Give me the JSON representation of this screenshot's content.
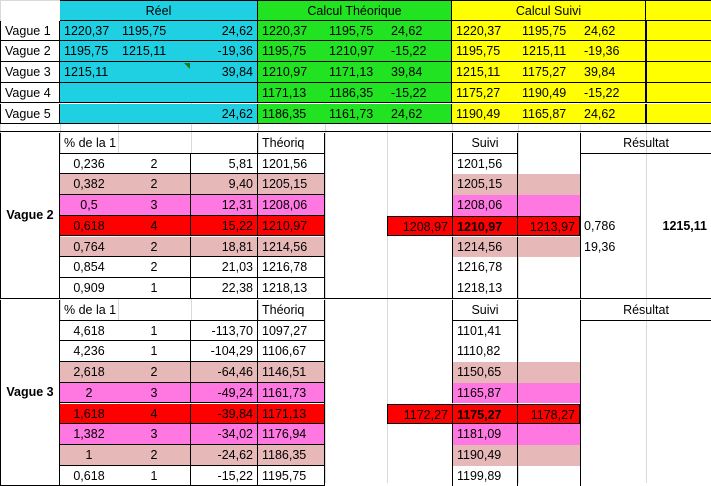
{
  "colors": {
    "cyan": "#1fd0e3",
    "green": "#21e321",
    "yellow": "#ffff00",
    "pink": "#e6b8b7",
    "magenta": "#ff77e0",
    "red": "#ff0000",
    "white": "#ffffff"
  },
  "sheet": {
    "top": {
      "headers": [
        "Réel",
        "Calcul Théorique",
        "Calcul Suivi"
      ],
      "rows": [
        {
          "label": "Vague 1",
          "reel": [
            "1220,37",
            "1195,75",
            "24,62"
          ],
          "theo": [
            "1220,37",
            "1195,75",
            "24,62"
          ],
          "suivi": [
            "1220,37",
            "1195,75",
            "24,62"
          ]
        },
        {
          "label": "Vague 2",
          "reel": [
            "1195,75",
            "1215,11",
            "-19,36"
          ],
          "theo": [
            "1195,75",
            "1210,97",
            "-15,22"
          ],
          "suivi": [
            "1195,75",
            "1215,11",
            "-19,36"
          ]
        },
        {
          "label": "Vague 3",
          "reel": [
            "1215,11",
            "",
            "39,84"
          ],
          "theo": [
            "1210,97",
            "1171,13",
            "39,84"
          ],
          "suivi": [
            "1215,11",
            "1175,27",
            "39,84"
          ]
        },
        {
          "label": "Vague 4",
          "reel": [
            "",
            "",
            ""
          ],
          "theo": [
            "1171,13",
            "1186,35",
            "-15,22"
          ],
          "suivi": [
            "1175,27",
            "1190,49",
            "-15,22"
          ]
        },
        {
          "label": "Vague 5",
          "reel": [
            "",
            "",
            "24,62"
          ],
          "theo": [
            "1186,35",
            "1161,73",
            "24,62"
          ],
          "suivi": [
            "1190,49",
            "1165,87",
            "24,62"
          ]
        }
      ]
    },
    "block1": {
      "label": "Vague 2",
      "headers": {
        "pct": "% de la 1",
        "theo": "Théoriq",
        "suivi": "Suivi",
        "result": "Résultat"
      },
      "rows": [
        {
          "pct": "0,236",
          "n": "2",
          "v": "5,81",
          "theo": "1201,56",
          "suivi": "1201,56",
          "bg": "white"
        },
        {
          "pct": "0,382",
          "n": "2",
          "v": "9,40",
          "theo": "1205,15",
          "suivi": "1205,15",
          "bg": "pink"
        },
        {
          "pct": "0,5",
          "n": "3",
          "v": "12,31",
          "theo": "1208,06",
          "suivi": "1208,06",
          "bg": "magenta"
        },
        {
          "pct": "0,618",
          "n": "4",
          "v": "15,22",
          "theo": "1210,97",
          "suivi": "1210,97",
          "bg": "red",
          "low": "1208,97",
          "high": "1213,97"
        },
        {
          "pct": "0,764",
          "n": "2",
          "v": "18,81",
          "theo": "1214,56",
          "suivi": "1214,56",
          "bg": "pink"
        },
        {
          "pct": "0,854",
          "n": "2",
          "v": "21,03",
          "theo": "1216,78",
          "suivi": "1216,78",
          "bg": "white"
        },
        {
          "pct": "0,909",
          "n": "1",
          "v": "22,38",
          "theo": "1218,13",
          "suivi": "1218,13",
          "bg": "white"
        }
      ],
      "result": {
        "ratio": "0,786",
        "value": "1215,11",
        "diff": "19,36"
      }
    },
    "block2": {
      "label": "Vague 3",
      "headers": {
        "pct": "% de la 1",
        "theo": "Théoriq",
        "suivi": "Suivi",
        "result": "Résultat"
      },
      "rows": [
        {
          "pct": "4,618",
          "n": "1",
          "v": "-113,70",
          "theo": "1097,27",
          "suivi": "1101,41",
          "bg": "white"
        },
        {
          "pct": "4,236",
          "n": "1",
          "v": "-104,29",
          "theo": "1106,67",
          "suivi": "1110,82",
          "bg": "white"
        },
        {
          "pct": "2,618",
          "n": "2",
          "v": "-64,46",
          "theo": "1146,51",
          "suivi": "1150,65",
          "bg": "pink"
        },
        {
          "pct": "2",
          "n": "3",
          "v": "-49,24",
          "theo": "1161,73",
          "suivi": "1165,87",
          "bg": "magenta"
        },
        {
          "pct": "1,618",
          "n": "4",
          "v": "-39,84",
          "theo": "1171,13",
          "suivi": "1175,27",
          "bg": "red",
          "low": "1172,27",
          "high": "1178,27"
        },
        {
          "pct": "1,382",
          "n": "3",
          "v": "-34,02",
          "theo": "1176,94",
          "suivi": "1181,09",
          "bg": "magenta"
        },
        {
          "pct": "1",
          "n": "2",
          "v": "-24,62",
          "theo": "1186,35",
          "suivi": "1190,49",
          "bg": "pink"
        },
        {
          "pct": "0,618",
          "n": "1",
          "v": "-15,22",
          "theo": "1195,75",
          "suivi": "1199,89",
          "bg": "white"
        }
      ]
    }
  }
}
